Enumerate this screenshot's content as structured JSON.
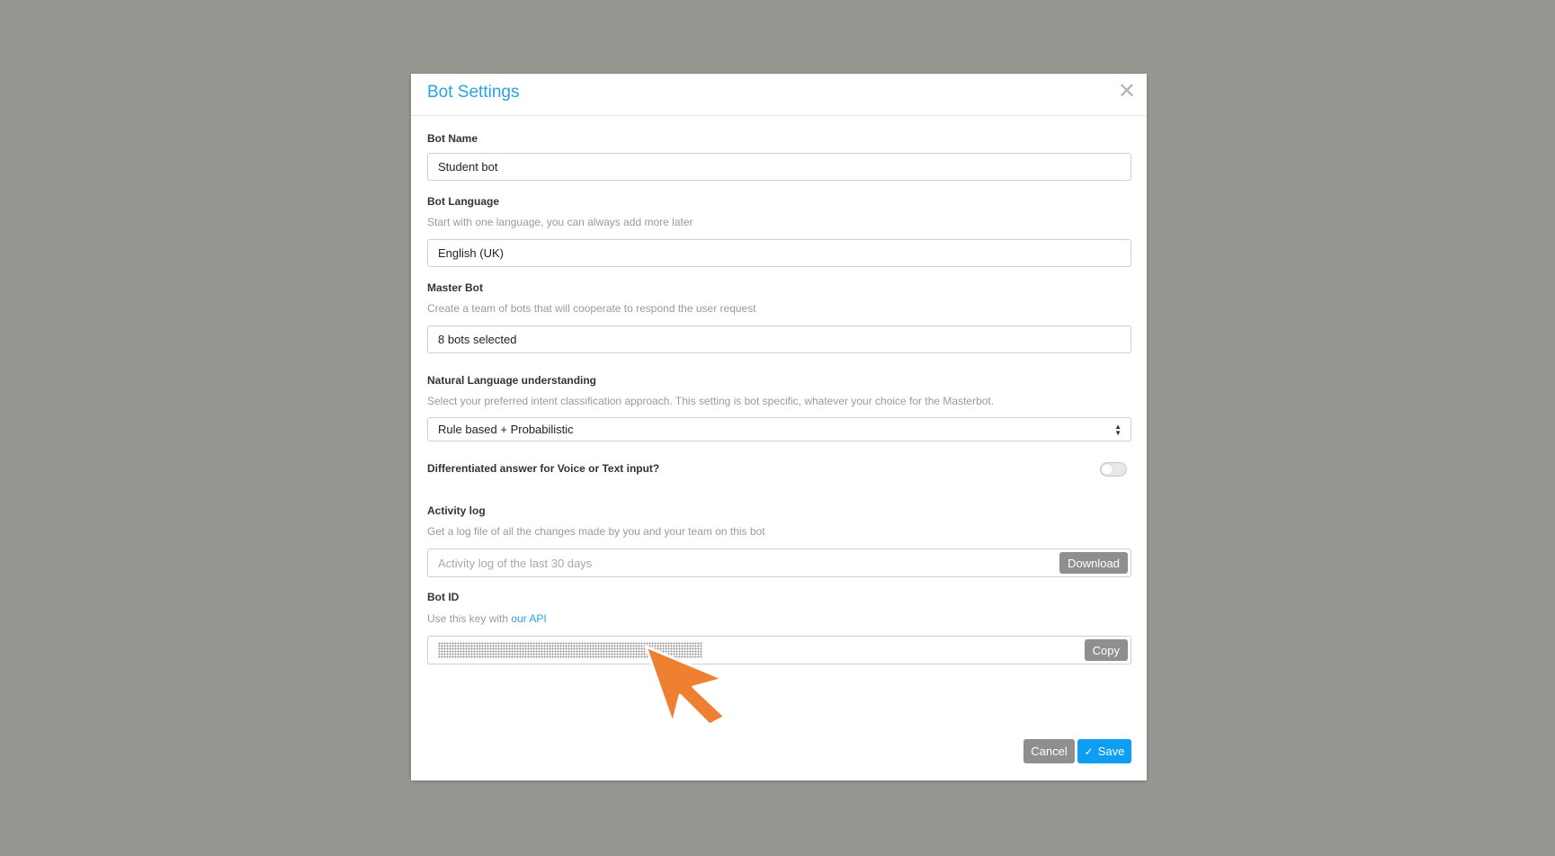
{
  "modal": {
    "title": "Bot Settings",
    "close_icon": "close-icon"
  },
  "bot_name": {
    "label": "Bot Name",
    "value": "Student bot"
  },
  "bot_language": {
    "label": "Bot Language",
    "help": "Start with one language, you can always add more later",
    "value": "English (UK)"
  },
  "master_bot": {
    "label": "Master Bot",
    "help": "Create a team of bots that will cooperate to respond the user request",
    "value": "8 bots selected"
  },
  "nlu": {
    "label": "Natural Language understanding",
    "help": "Select your preferred intent classification approach. This setting is bot specific, whatever your choice for the Masterbot.",
    "selected": "Rule based + Probabilistic"
  },
  "differentiated": {
    "label": "Differentiated answer for Voice or Text input?",
    "enabled": false
  },
  "activity_log": {
    "label": "Activity log",
    "help": "Get a log file of all the changes made by you and your team on this bot",
    "placeholder": "Activity log of the last 30 days",
    "button": "Download"
  },
  "bot_id": {
    "label": "Bot ID",
    "help_prefix": "Use this key with ",
    "help_link": "our API",
    "button": "Copy"
  },
  "footer": {
    "cancel": "Cancel",
    "save": "Save"
  },
  "colors": {
    "accent": "#28a3e3",
    "save_button": "#0e9df0",
    "secondary_button": "#8f8f8f",
    "backdrop": "#979792",
    "cursor": "#ef7f31"
  }
}
